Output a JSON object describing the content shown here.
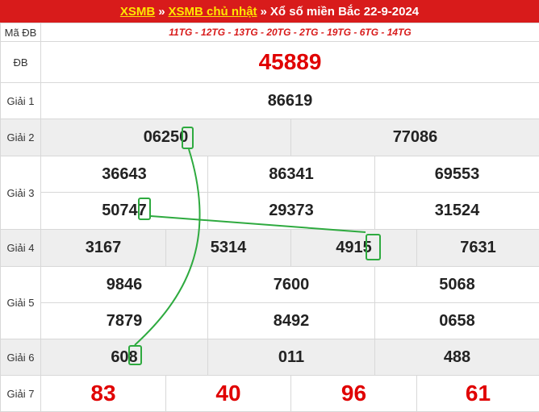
{
  "header": {
    "link1": "XSMB",
    "sep1": "»",
    "link2": "XSMB chủ nhật",
    "sep2": "»",
    "title": "Xổ số miền Bắc 22-9-2024"
  },
  "rows": {
    "ma_db": {
      "label": "Mã ĐB",
      "codes": "11TG - 12TG - 13TG - 20TG - 2TG - 19TG - 6TG - 14TG"
    },
    "db": {
      "label": "ĐB",
      "values": [
        "45889"
      ]
    },
    "g1": {
      "label": "Giải 1",
      "values": [
        "86619"
      ]
    },
    "g2": {
      "label": "Giải 2",
      "values": [
        "06250",
        "77086"
      ]
    },
    "g3": {
      "label": "Giải 3",
      "values": [
        "36643",
        "86341",
        "69553",
        "50747",
        "29373",
        "31524"
      ]
    },
    "g4": {
      "label": "Giải 4",
      "values": [
        "3167",
        "5314",
        "4915",
        "7631"
      ]
    },
    "g5": {
      "label": "Giải 5",
      "values": [
        "9846",
        "7600",
        "5068",
        "7879",
        "8492",
        "0658"
      ]
    },
    "g6": {
      "label": "Giải 6",
      "values": [
        "608",
        "011",
        "488"
      ]
    },
    "g7": {
      "label": "Giải 7",
      "values": [
        "83",
        "40",
        "96",
        "61"
      ]
    }
  },
  "colors": {
    "header_bg": "#d81b1b",
    "link": "#ffe600",
    "highlight": "#e00000",
    "marker": "#2eaa3f",
    "shade": "#eeeeee"
  }
}
